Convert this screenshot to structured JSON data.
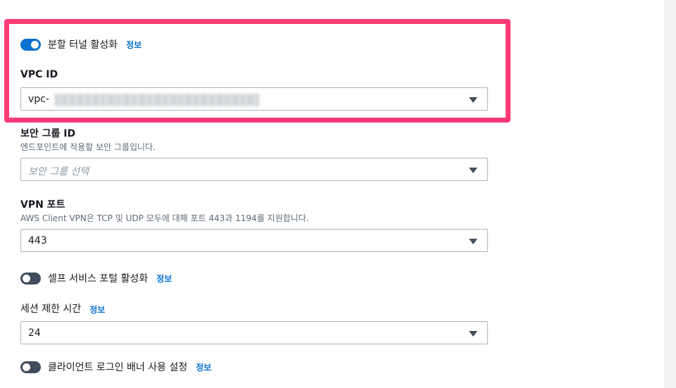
{
  "split_tunnel": {
    "label": "분할 터널 활성화",
    "info": "정보",
    "enabled": true
  },
  "vpc": {
    "label": "VPC ID",
    "value": "vpc-"
  },
  "security_group": {
    "label": "보안 그룹 ID",
    "description": "엔드포인트에 적용할 보안 그룹입니다.",
    "placeholder": "보안 그룹 선택"
  },
  "vpn_port": {
    "label": "VPN 포트",
    "description": "AWS Client VPN은 TCP 및 UDP 모두에 대해 포트 443과 1194를 지원합니다.",
    "value": "443"
  },
  "self_service": {
    "label": "셀프 서비스 포털 활성화",
    "info": "정보",
    "enabled": false
  },
  "session_timeout": {
    "label": "세션 제한 시간",
    "info": "정보",
    "value": "24"
  },
  "client_banner": {
    "label": "클라이언트 로그인 배너 사용 설정",
    "info": "정보",
    "enabled": false
  },
  "colors": {
    "accent": "#0972d3",
    "highlight": "#ff3b77"
  },
  "icons": {
    "caret": "caret-down-icon"
  }
}
